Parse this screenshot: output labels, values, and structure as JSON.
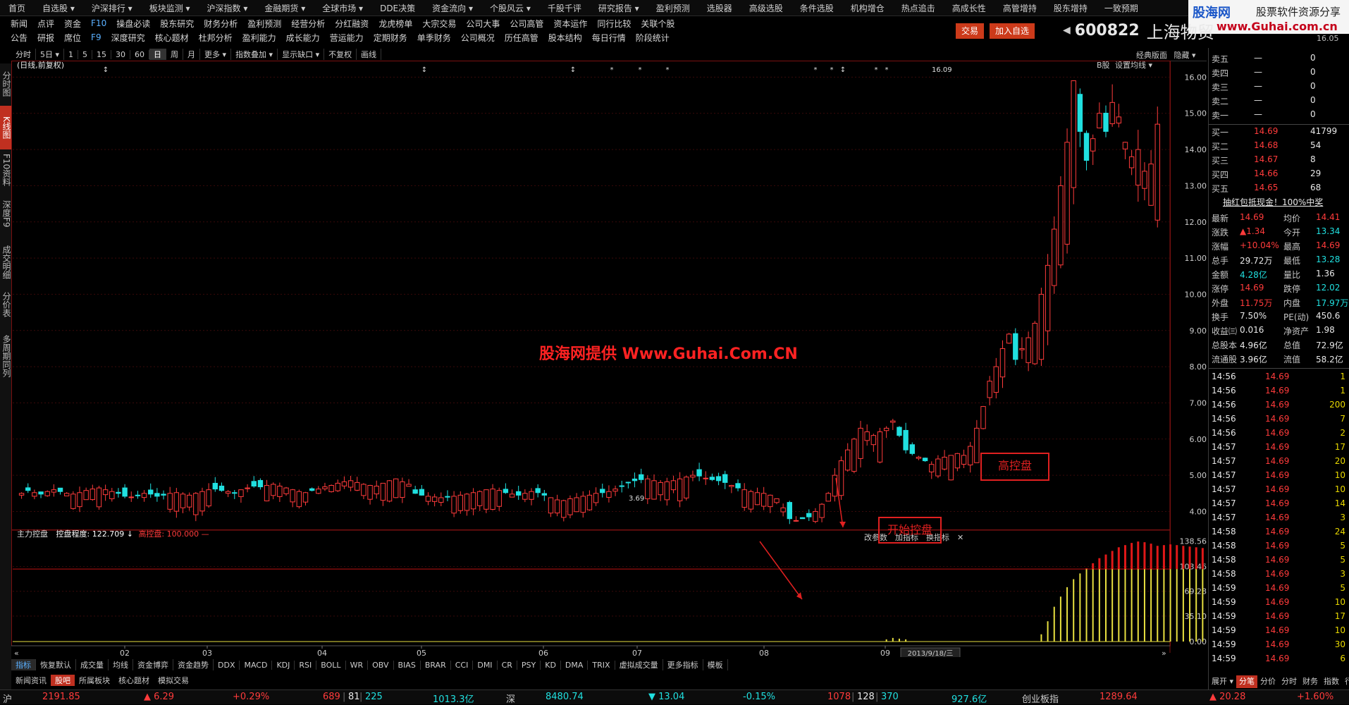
{
  "menu": [
    "首页",
    "自选股 ▾",
    "沪深排行 ▾",
    "板块监测 ▾",
    "沪深指数 ▾",
    "金融期货 ▾",
    "全球市场 ▾",
    "DDE决策",
    "资金流向 ▾",
    "个股风云 ▾",
    "千股千评",
    "研究报告 ▾",
    "盈利预测",
    "选股器",
    "高级选股",
    "条件选股",
    "机构增仓",
    "热点追击",
    "高成长性",
    "高管增持",
    "股东增持",
    "一致预期"
  ],
  "submenu_row1": [
    "新闻",
    "点评",
    "资金",
    "F10",
    "操盘必读",
    "股东研究",
    "财务分析",
    "盈利预测",
    "经营分析",
    "分红融资",
    "龙虎榜单",
    "大宗交易",
    "公司大事",
    "公司高管",
    "资本运作",
    "同行比较",
    "关联个股"
  ],
  "submenu_row2": [
    "公告",
    "研报",
    "席位",
    "F9",
    "深度研究",
    "核心题材",
    "杜邦分析",
    "盈利能力",
    "成长能力",
    "营运能力",
    "定期财务",
    "单季财务",
    "公司概况",
    "历任高管",
    "股本结构",
    "每日行情",
    "阶段统计"
  ],
  "logo": {
    "a": "股海网",
    "b": "股票软件资源分享",
    "c": "www.Guhai.com.cn"
  },
  "buttons": {
    "trade": "交易",
    "add_watch": "加入自选"
  },
  "stock": {
    "code": "600822",
    "name": "上海物贸",
    "corner": "16.05"
  },
  "toolbar": [
    "分时",
    "5日 ▾",
    "1",
    "5",
    "15",
    "30",
    "60",
    "日",
    "周",
    "月",
    "更多 ▾",
    "指数叠加 ▾",
    "显示缺口 ▾",
    "不复权",
    "画线"
  ],
  "sidetabs": [
    "分时图",
    "K线图",
    "F10资料",
    "深度F9",
    "成交明细",
    "分价表",
    "多周期同列"
  ],
  "chart_label": "(日线,前复权)",
  "chart_buttons": {
    "b": "B股",
    "avg": "设置均线 ▾",
    "classic": "经典版面",
    "hide": "隐藏 ▾"
  },
  "indicator": {
    "name": "主力控盘",
    "level_label": "控盘程度:",
    "level_value": "122.709",
    "level_arrow": "↓",
    "high_label": "高控盘:",
    "high_value": "100.000",
    "dash": "—"
  },
  "indicator_buttons": [
    "改参数",
    "加指标",
    "换指标",
    "✕"
  ],
  "annotations": {
    "start": "开始控盘",
    "high": "高控盘"
  },
  "watermark": "股海网提供 Www.Guhai.Com.CN",
  "date_box": "2013/9/18/三",
  "bottomtabs": [
    "指标",
    "恢复默认",
    "成交量",
    "均线",
    "资金博弈",
    "资金趋势",
    "DDX",
    "MACD",
    "KDJ",
    "RSI",
    "BOLL",
    "WR",
    "OBV",
    "BIAS",
    "BRAR",
    "CCI",
    "DMI",
    "CR",
    "PSY",
    "KD",
    "DMA",
    "TRIX",
    "虚拟成交量",
    "更多指标",
    "模板"
  ],
  "newsbar": [
    "新闻资讯",
    "股吧",
    "所属板块",
    "核心题材",
    "模拟交易"
  ],
  "rp_mini_tabs": [
    "展开 ▾",
    "分笔",
    "分价",
    "分时",
    "财务",
    "指数",
    "行业"
  ],
  "status": {
    "sh_label": "沪",
    "sh_val": "2191.85",
    "sh_chg": "▲ 6.29",
    "sh_pct": "+0.29%",
    "sh_cnt": "689",
    "sh_c2": "81",
    "sh_c3": "225",
    "sh_amt": "1013.3亿",
    "sz_label": "深",
    "sz_val": "8480.74",
    "sz_chg": "▼ 13.04",
    "sz_pct": "-0.15%",
    "sz_cnt": "1078",
    "sz_c2": "128",
    "sz_c3": "370",
    "sz_amt": "927.6亿",
    "cy_label": "创业板指",
    "cy_val": "1289.64",
    "cy_chg": "▲ 20.28",
    "cy_pct": "+1.60%"
  },
  "orderbook": {
    "sell": [
      {
        "l": "卖五",
        "p": "—",
        "v": "0"
      },
      {
        "l": "卖四",
        "p": "—",
        "v": "0"
      },
      {
        "l": "卖三",
        "p": "—",
        "v": "0"
      },
      {
        "l": "卖二",
        "p": "—",
        "v": "0"
      },
      {
        "l": "卖一",
        "p": "—",
        "v": "0"
      }
    ],
    "buy": [
      {
        "l": "买一",
        "p": "14.69",
        "v": "41799"
      },
      {
        "l": "买二",
        "p": "14.68",
        "v": "54"
      },
      {
        "l": "买三",
        "p": "14.67",
        "v": "8"
      },
      {
        "l": "买四",
        "p": "14.66",
        "v": "29"
      },
      {
        "l": "买五",
        "p": "14.65",
        "v": "68"
      }
    ]
  },
  "promo": "抽红包抵现金！100%中奖",
  "quote": [
    {
      "a": "最新",
      "av": "14.69",
      "b": "均价",
      "bv": "14.41",
      "ac": "red",
      "bc": "red"
    },
    {
      "a": "涨跌",
      "av": "▲1.34",
      "b": "今开",
      "bv": "13.34",
      "ac": "red",
      "bc": "green"
    },
    {
      "a": "涨幅",
      "av": "+10.04%",
      "b": "最高",
      "bv": "14.69",
      "ac": "red",
      "bc": "red"
    },
    {
      "a": "总手",
      "av": "29.72万",
      "b": "最低",
      "bv": "13.28",
      "ac": "white",
      "bc": "green"
    },
    {
      "a": "金额",
      "av": "4.28亿",
      "b": "量比",
      "bv": "1.36",
      "ac": "green",
      "bc": "white"
    },
    {
      "a": "涨停",
      "av": "14.69",
      "b": "跌停",
      "bv": "12.02",
      "ac": "red",
      "bc": "green"
    },
    {
      "a": "外盘",
      "av": "11.75万",
      "b": "内盘",
      "bv": "17.97万",
      "ac": "red",
      "bc": "green"
    },
    {
      "a": "换手",
      "av": "7.50%",
      "b": "PE(动)",
      "bv": "450.6",
      "ac": "white",
      "bc": "white"
    },
    {
      "a": "收益㈢",
      "av": "0.016",
      "b": "净资产",
      "bv": "1.98",
      "ac": "white",
      "bc": "white"
    },
    {
      "a": "总股本",
      "av": "4.96亿",
      "b": "总值",
      "bv": "72.9亿",
      "ac": "white",
      "bc": "white"
    },
    {
      "a": "流通股",
      "av": "3.96亿",
      "b": "流值",
      "bv": "58.2亿",
      "ac": "white",
      "bc": "white"
    }
  ],
  "ticks": [
    {
      "t": "14:56",
      "p": "14.69",
      "v": "1"
    },
    {
      "t": "14:56",
      "p": "14.69",
      "v": "1"
    },
    {
      "t": "14:56",
      "p": "14.69",
      "v": "200"
    },
    {
      "t": "14:56",
      "p": "14.69",
      "v": "7"
    },
    {
      "t": "14:56",
      "p": "14.69",
      "v": "2"
    },
    {
      "t": "14:57",
      "p": "14.69",
      "v": "17"
    },
    {
      "t": "14:57",
      "p": "14.69",
      "v": "20"
    },
    {
      "t": "14:57",
      "p": "14.69",
      "v": "10"
    },
    {
      "t": "14:57",
      "p": "14.69",
      "v": "10"
    },
    {
      "t": "14:57",
      "p": "14.69",
      "v": "14"
    },
    {
      "t": "14:57",
      "p": "14.69",
      "v": "3"
    },
    {
      "t": "14:58",
      "p": "14.69",
      "v": "24"
    },
    {
      "t": "14:58",
      "p": "14.69",
      "v": "5"
    },
    {
      "t": "14:58",
      "p": "14.69",
      "v": "5"
    },
    {
      "t": "14:58",
      "p": "14.69",
      "v": "3"
    },
    {
      "t": "14:59",
      "p": "14.69",
      "v": "5"
    },
    {
      "t": "14:59",
      "p": "14.69",
      "v": "10"
    },
    {
      "t": "14:59",
      "p": "14.69",
      "v": "17"
    },
    {
      "t": "14:59",
      "p": "14.69",
      "v": "10"
    },
    {
      "t": "14:59",
      "p": "14.69",
      "v": "30"
    },
    {
      "t": "14:59",
      "p": "14.69",
      "v": "6"
    }
  ],
  "colors": {
    "up": "#ff3b3b",
    "down": "#20e0e0",
    "bg": "#000000",
    "grid": "#7a1010",
    "yellow": "#e8e040"
  },
  "chart_data": [
    {
      "type": "candlestick",
      "title": "(日线,前复权)",
      "ylim": [
        3.6,
        16.3
      ],
      "y_ticks": [
        "16.00",
        "15.00",
        "14.00",
        "13.00",
        "12.00",
        "11.00",
        "10.00",
        "9.00",
        "8.00",
        "7.00",
        "6.00",
        "5.00",
        "4.00"
      ],
      "x_tick_labels": [
        "02",
        "03",
        "04",
        "05",
        "06",
        "07",
        "08",
        "09"
      ],
      "annotations": [
        "16.09",
        "3.69"
      ],
      "markers": [
        "↕",
        "↕",
        "↕",
        "*",
        "*",
        "*",
        "*",
        "*",
        "↕",
        "*",
        "*"
      ],
      "close": [
        4.5,
        4.58,
        4.52,
        4.48,
        4.55,
        4.6,
        4.55,
        4.5,
        4.48,
        4.52,
        4.58,
        4.62,
        4.65,
        4.6,
        4.55,
        4.5,
        4.42,
        4.4,
        4.45,
        4.5,
        4.48,
        4.42,
        4.45,
        4.5,
        4.52,
        4.48,
        4.45,
        4.5,
        4.55,
        4.6,
        4.62,
        4.58,
        4.55,
        4.52,
        4.6,
        4.65,
        4.7,
        4.68,
        4.72,
        4.75,
        4.7,
        4.65,
        4.6,
        4.55,
        4.52,
        4.58,
        4.62,
        4.68,
        4.72,
        4.78,
        4.82,
        4.85,
        4.8,
        4.75,
        4.72,
        4.7,
        4.78,
        4.85,
        4.9,
        4.82,
        4.75,
        4.5,
        4.45,
        4.42,
        4.4,
        4.38,
        4.4,
        4.42,
        4.45,
        4.48,
        4.52,
        4.55,
        4.6,
        4.62,
        4.58,
        4.52,
        4.48,
        4.45,
        4.5,
        4.55,
        4.52,
        4.45,
        4.38,
        4.32,
        4.3,
        4.35,
        4.38,
        4.42,
        4.45,
        4.5,
        4.52,
        4.55,
        4.62,
        4.7,
        4.8,
        4.85,
        4.88,
        4.9,
        4.85,
        4.8,
        4.82,
        4.85,
        4.9,
        4.95,
        5.0,
        4.98,
        4.92,
        4.88,
        4.85,
        4.8,
        4.72,
        4.65,
        4.6,
        4.55,
        4.52,
        4.5,
        4.45,
        4.35,
        4.1,
        3.8,
        3.75,
        3.8,
        3.85,
        4.0,
        4.2,
        4.5,
        5.0,
        5.4,
        5.7,
        6.0,
        6.3,
        6.2,
        6.1,
        6.2,
        6.3,
        6.5,
        6.1,
        5.7,
        5.6,
        5.5,
        5.4,
        5.3,
        5.45,
        5.5,
        5.55,
        5.6,
        5.55,
        5.8,
        6.3,
        6.9,
        7.6,
        8.0,
        8.5,
        8.9,
        8.2,
        8.5,
        8.8,
        9.2,
        10.0,
        10.8,
        11.8,
        13.0,
        14.2,
        15.9,
        14.5,
        13.7,
        14.3,
        15.0,
        14.5,
        15.3,
        14.9,
        14.2,
        13.8,
        14.0,
        13.4,
        13.6,
        14.7
      ]
    },
    {
      "type": "bar",
      "title": "主力控盘",
      "ylim": [
        0,
        140
      ],
      "y_ticks": [
        "138.56",
        "103.46",
        "69.28",
        "35.10",
        "0.00"
      ],
      "threshold": 100,
      "values": [
        0,
        0,
        0,
        0,
        0,
        0,
        0,
        0,
        0,
        0,
        0,
        0,
        0,
        0,
        0,
        0,
        0,
        0,
        0,
        0,
        0,
        0,
        0,
        0,
        0,
        0,
        0,
        0,
        0,
        0,
        0,
        0,
        0,
        0,
        0,
        0,
        0,
        0,
        0,
        0,
        0,
        0,
        0,
        0,
        0,
        0,
        0,
        0,
        0,
        0,
        0,
        0,
        0,
        0,
        0,
        0,
        0,
        0,
        0,
        0,
        0,
        0,
        0,
        0,
        0,
        0,
        0,
        0,
        0,
        0,
        0,
        0,
        0,
        0,
        0,
        0,
        0,
        0,
        0,
        0,
        0,
        0,
        0,
        0,
        0,
        0,
        0,
        0,
        0,
        0,
        0,
        0,
        0,
        0,
        0,
        0,
        0,
        0,
        0,
        0,
        0,
        0,
        0,
        0,
        0,
        0,
        0,
        0,
        0,
        0,
        0,
        0,
        0,
        0,
        0,
        0,
        0,
        0,
        0,
        0,
        0,
        0,
        0,
        0,
        0,
        0,
        0,
        0,
        0,
        0,
        0,
        0,
        0,
        0,
        3,
        5,
        4,
        3,
        0,
        0,
        0,
        0,
        0,
        0,
        0,
        0,
        0,
        0,
        0,
        0,
        0,
        0,
        0,
        0,
        0,
        0,
        0,
        0,
        10,
        28,
        48,
        62,
        75,
        86,
        94,
        101,
        108,
        115,
        120,
        125,
        130,
        133,
        136,
        138,
        137,
        135,
        132,
        133,
        134,
        133,
        132,
        131,
        130,
        129,
        128,
        124,
        120
      ]
    }
  ]
}
